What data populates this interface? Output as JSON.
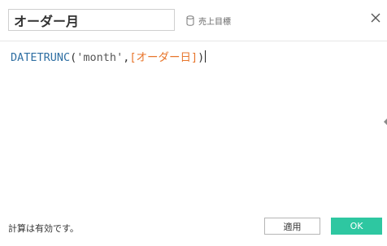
{
  "dialog": {
    "field_name": "オーダー月",
    "datasource_label": "売上目標",
    "close_icon": "close-icon",
    "datasource_icon": "database-icon"
  },
  "formula": {
    "function": "DATETRUNC",
    "open_paren": "(",
    "string_literal": "'month'",
    "comma": ",",
    "field": "[オーダー日]",
    "close_paren": ")"
  },
  "footer": {
    "status": "計算は有効です。",
    "apply_label": "適用",
    "ok_label": "OK"
  },
  "colors": {
    "function": "#2f6fa3",
    "field": "#e8762c",
    "ok_button": "#2ec7a1"
  }
}
